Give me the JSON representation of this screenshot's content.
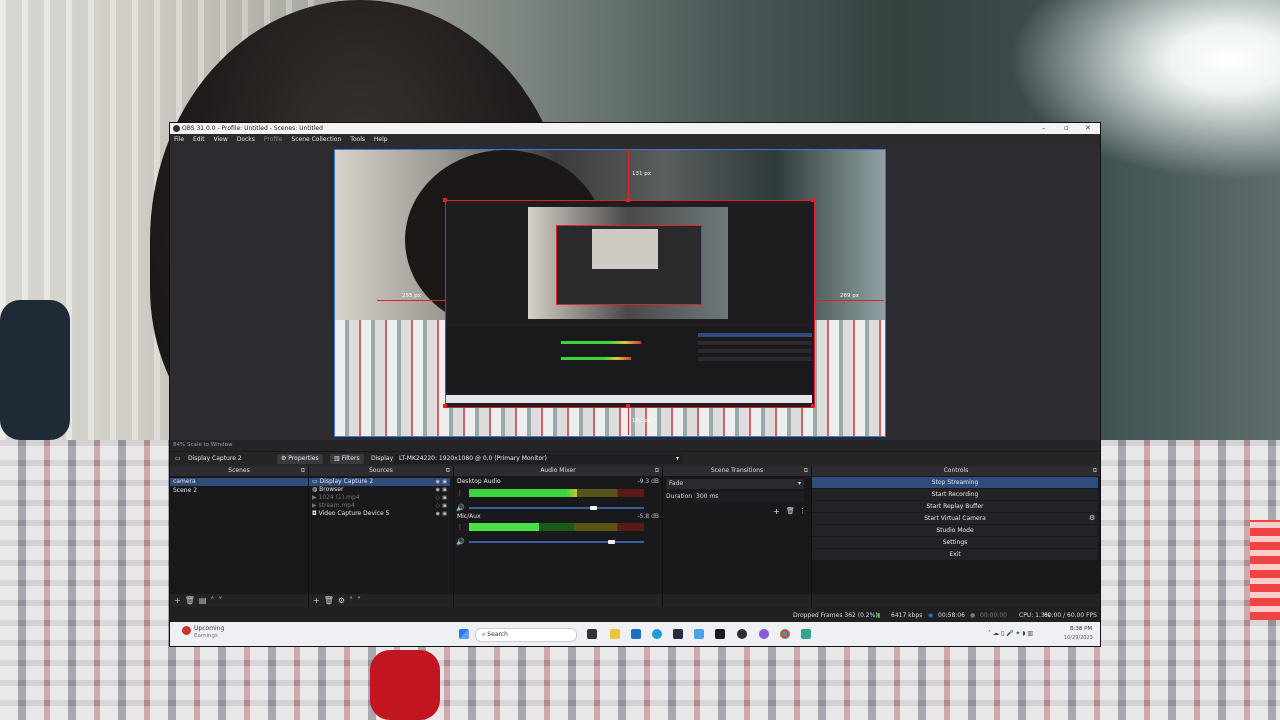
{
  "window": {
    "title": "OBS 31.0.0 - Profile: Untitled - Scenes: Untitled",
    "controls": {
      "minimize": "–",
      "maximize": "▫",
      "close": "✕"
    }
  },
  "menu": [
    "File",
    "Edit",
    "View",
    "Docks",
    "Profile",
    "Scene Collection",
    "Tools",
    "Help"
  ],
  "preview": {
    "guide_top": "131 px",
    "guide_left": "255 px",
    "guide_right": "269 px",
    "guide_bottom": "192 px",
    "scale_label": "84% Scale to Window"
  },
  "source_toolbar": {
    "selected_source": "Display Capture 2",
    "properties_label": "Properties",
    "filters_label": "Filters",
    "display_label": "Display",
    "display_value": "LT-MK24220: 1920x1080 @ 0,0 (Primary Monitor)"
  },
  "docks": {
    "scenes": {
      "title": "Scenes",
      "items": [
        "camera",
        "Scene 2"
      ],
      "selected": "camera"
    },
    "sources": {
      "title": "Sources",
      "items": [
        {
          "name": "Display Capture 2",
          "icon": "monitor-icon",
          "dim": false
        },
        {
          "name": "Browser",
          "icon": "globe-icon",
          "dim": false
        },
        {
          "name": "1024 (1).mp4",
          "icon": "play-icon",
          "dim": true
        },
        {
          "name": "stream.mp4",
          "icon": "play-icon",
          "dim": true
        },
        {
          "name": "Video Capture Device 5",
          "icon": "camera-icon",
          "dim": false
        }
      ]
    },
    "audio_mixer": {
      "title": "Audio Mixer",
      "channels": [
        {
          "name": "Desktop Audio",
          "db": "-9.3 dB",
          "level": 0.62,
          "volume": 0.72
        },
        {
          "name": "Mic/Aux",
          "db": "-5.8 dB",
          "level": 0.4,
          "volume": 0.82
        }
      ],
      "scale": [
        "-60",
        "-55",
        "-50",
        "-45",
        "-40",
        "-35",
        "-30",
        "-25",
        "-20",
        "-15",
        "-10",
        "-5",
        "0"
      ]
    },
    "scene_transitions": {
      "title": "Scene Transitions",
      "transition": "Fade",
      "duration_label": "Duration",
      "duration_value": "300 ms"
    },
    "controls": {
      "title": "Controls",
      "buttons": [
        "Stop Streaming",
        "Start Recording",
        "Start Replay Buffer",
        "Start Virtual Camera",
        "Studio Mode",
        "Settings",
        "Exit"
      ]
    }
  },
  "status": {
    "dropped_frames": "Dropped Frames 362 (0.2%)",
    "bitrate": "6417 kbps",
    "stream_time": "00:58:06",
    "record_time": "00:00:00",
    "cpu": "CPU: 1.3%",
    "fps": "60.00 / 60.00 FPS"
  },
  "taskbar": {
    "weather_title": "Upcoming",
    "weather_sub": "Earnings",
    "search_placeholder": "Search",
    "time": "8:38 PM",
    "date": "10/29/2023"
  }
}
